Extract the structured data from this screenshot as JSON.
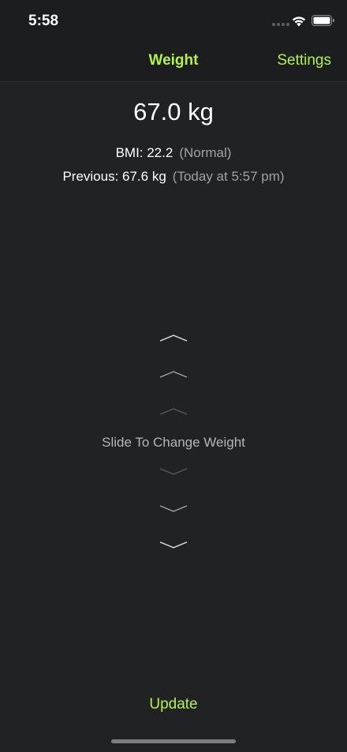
{
  "status_bar": {
    "time": "5:58"
  },
  "nav": {
    "title": "Weight",
    "settings_label": "Settings"
  },
  "weight": {
    "value": "67.0 kg"
  },
  "bmi": {
    "label": "BMI: 22.2",
    "category": "(Normal)"
  },
  "previous": {
    "label": "Previous: 67.6 kg",
    "when": "(Today at 5:57 pm)"
  },
  "slider": {
    "label": "Slide To Change Weight"
  },
  "footer": {
    "update_label": "Update"
  },
  "colors": {
    "accent": "#b2f146",
    "background": "#212224",
    "bar_background": "#1c1d1e"
  }
}
